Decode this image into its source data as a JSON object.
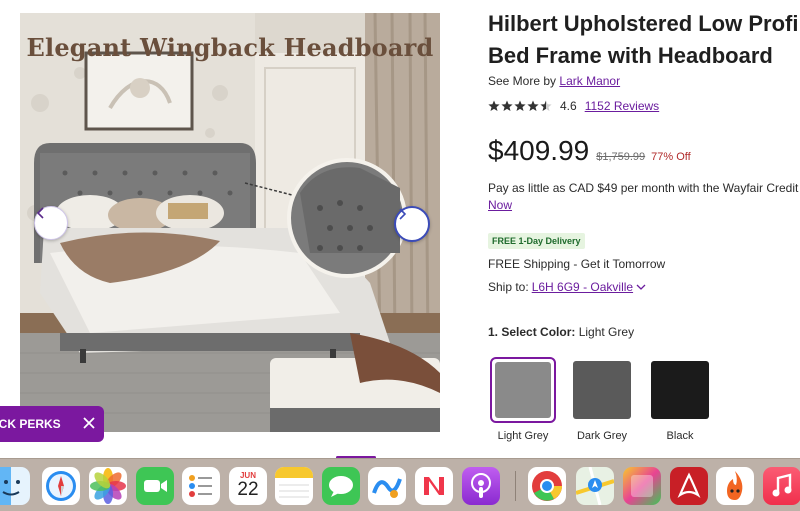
{
  "gallery": {
    "image_title": "Elegant Wingback Headboard",
    "prev_icon": "chevron-left-icon",
    "next_icon": "chevron-right-icon"
  },
  "perks": {
    "label": "LOCK PERKS",
    "close_icon": "close-icon"
  },
  "product": {
    "title_line1": "Hilbert Upholstered Low Profile",
    "title_line2": "Bed Frame with Headboard",
    "see_more_prefix": "See More by",
    "brand": "Lark Manor",
    "rating": "4.6",
    "rating_stars": 4.5,
    "reviews": "1152 Reviews",
    "price": "$409.99",
    "was_price": "$1,759.99",
    "discount": "77% Off",
    "pay_text": "Pay as little as CAD $49 per month with the Wayfair Credit",
    "pay_link": "Now",
    "delivery_badge": "FREE 1-Day Delivery",
    "shipping": "FREE Shipping - Get it Tomorrow",
    "ship_to_label": "Ship to:",
    "ship_to_value": "L6H 6G9 - Oakville",
    "color_label": "1. Select Color:",
    "color_selected": "Light Grey"
  },
  "swatches": [
    {
      "name": "Light Grey",
      "color": "#8a8a8a",
      "selected": true
    },
    {
      "name": "Dark Grey",
      "color": "#5a5a5a",
      "selected": false
    },
    {
      "name": "Black",
      "color": "#1b1b1b",
      "selected": false
    }
  ],
  "dock": {
    "calendar_month": "JUN",
    "calendar_day": "22",
    "apps": [
      "finder-icon",
      "safari-icon",
      "photos-icon",
      "facetime-icon",
      "reminders-icon",
      "calendar-icon",
      "notes-icon",
      "messages-icon",
      "freeform-icon",
      "news-icon",
      "podcasts-icon",
      "chrome-icon",
      "maps-icon",
      "preview-icon",
      "acrobat-icon",
      "hotspot-icon",
      "music-icon"
    ]
  },
  "colors": {
    "accent": "#7b189f",
    "link": "#6b1d9e",
    "discount": "#b12a2a"
  }
}
